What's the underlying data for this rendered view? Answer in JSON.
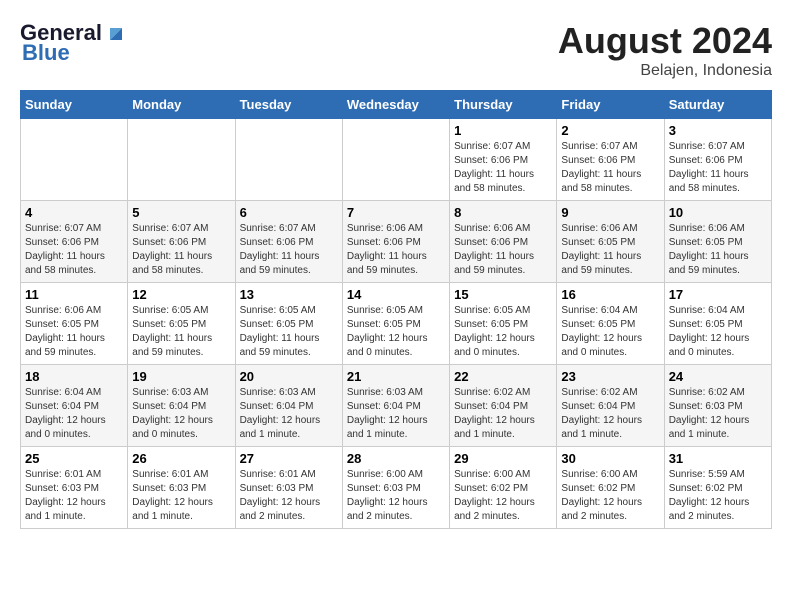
{
  "header": {
    "logo_line1": "General",
    "logo_line2": "Blue",
    "month_year": "August 2024",
    "location": "Belajen, Indonesia"
  },
  "weekdays": [
    "Sunday",
    "Monday",
    "Tuesday",
    "Wednesday",
    "Thursday",
    "Friday",
    "Saturday"
  ],
  "weeks": [
    [
      {
        "day": "",
        "info": ""
      },
      {
        "day": "",
        "info": ""
      },
      {
        "day": "",
        "info": ""
      },
      {
        "day": "",
        "info": ""
      },
      {
        "day": "1",
        "info": "Sunrise: 6:07 AM\nSunset: 6:06 PM\nDaylight: 11 hours\nand 58 minutes."
      },
      {
        "day": "2",
        "info": "Sunrise: 6:07 AM\nSunset: 6:06 PM\nDaylight: 11 hours\nand 58 minutes."
      },
      {
        "day": "3",
        "info": "Sunrise: 6:07 AM\nSunset: 6:06 PM\nDaylight: 11 hours\nand 58 minutes."
      }
    ],
    [
      {
        "day": "4",
        "info": "Sunrise: 6:07 AM\nSunset: 6:06 PM\nDaylight: 11 hours\nand 58 minutes."
      },
      {
        "day": "5",
        "info": "Sunrise: 6:07 AM\nSunset: 6:06 PM\nDaylight: 11 hours\nand 58 minutes."
      },
      {
        "day": "6",
        "info": "Sunrise: 6:07 AM\nSunset: 6:06 PM\nDaylight: 11 hours\nand 59 minutes."
      },
      {
        "day": "7",
        "info": "Sunrise: 6:06 AM\nSunset: 6:06 PM\nDaylight: 11 hours\nand 59 minutes."
      },
      {
        "day": "8",
        "info": "Sunrise: 6:06 AM\nSunset: 6:06 PM\nDaylight: 11 hours\nand 59 minutes."
      },
      {
        "day": "9",
        "info": "Sunrise: 6:06 AM\nSunset: 6:05 PM\nDaylight: 11 hours\nand 59 minutes."
      },
      {
        "day": "10",
        "info": "Sunrise: 6:06 AM\nSunset: 6:05 PM\nDaylight: 11 hours\nand 59 minutes."
      }
    ],
    [
      {
        "day": "11",
        "info": "Sunrise: 6:06 AM\nSunset: 6:05 PM\nDaylight: 11 hours\nand 59 minutes."
      },
      {
        "day": "12",
        "info": "Sunrise: 6:05 AM\nSunset: 6:05 PM\nDaylight: 11 hours\nand 59 minutes."
      },
      {
        "day": "13",
        "info": "Sunrise: 6:05 AM\nSunset: 6:05 PM\nDaylight: 11 hours\nand 59 minutes."
      },
      {
        "day": "14",
        "info": "Sunrise: 6:05 AM\nSunset: 6:05 PM\nDaylight: 12 hours\nand 0 minutes."
      },
      {
        "day": "15",
        "info": "Sunrise: 6:05 AM\nSunset: 6:05 PM\nDaylight: 12 hours\nand 0 minutes."
      },
      {
        "day": "16",
        "info": "Sunrise: 6:04 AM\nSunset: 6:05 PM\nDaylight: 12 hours\nand 0 minutes."
      },
      {
        "day": "17",
        "info": "Sunrise: 6:04 AM\nSunset: 6:05 PM\nDaylight: 12 hours\nand 0 minutes."
      }
    ],
    [
      {
        "day": "18",
        "info": "Sunrise: 6:04 AM\nSunset: 6:04 PM\nDaylight: 12 hours\nand 0 minutes."
      },
      {
        "day": "19",
        "info": "Sunrise: 6:03 AM\nSunset: 6:04 PM\nDaylight: 12 hours\nand 0 minutes."
      },
      {
        "day": "20",
        "info": "Sunrise: 6:03 AM\nSunset: 6:04 PM\nDaylight: 12 hours\nand 1 minute."
      },
      {
        "day": "21",
        "info": "Sunrise: 6:03 AM\nSunset: 6:04 PM\nDaylight: 12 hours\nand 1 minute."
      },
      {
        "day": "22",
        "info": "Sunrise: 6:02 AM\nSunset: 6:04 PM\nDaylight: 12 hours\nand 1 minute."
      },
      {
        "day": "23",
        "info": "Sunrise: 6:02 AM\nSunset: 6:04 PM\nDaylight: 12 hours\nand 1 minute."
      },
      {
        "day": "24",
        "info": "Sunrise: 6:02 AM\nSunset: 6:03 PM\nDaylight: 12 hours\nand 1 minute."
      }
    ],
    [
      {
        "day": "25",
        "info": "Sunrise: 6:01 AM\nSunset: 6:03 PM\nDaylight: 12 hours\nand 1 minute."
      },
      {
        "day": "26",
        "info": "Sunrise: 6:01 AM\nSunset: 6:03 PM\nDaylight: 12 hours\nand 1 minute."
      },
      {
        "day": "27",
        "info": "Sunrise: 6:01 AM\nSunset: 6:03 PM\nDaylight: 12 hours\nand 2 minutes."
      },
      {
        "day": "28",
        "info": "Sunrise: 6:00 AM\nSunset: 6:03 PM\nDaylight: 12 hours\nand 2 minutes."
      },
      {
        "day": "29",
        "info": "Sunrise: 6:00 AM\nSunset: 6:02 PM\nDaylight: 12 hours\nand 2 minutes."
      },
      {
        "day": "30",
        "info": "Sunrise: 6:00 AM\nSunset: 6:02 PM\nDaylight: 12 hours\nand 2 minutes."
      },
      {
        "day": "31",
        "info": "Sunrise: 5:59 AM\nSunset: 6:02 PM\nDaylight: 12 hours\nand 2 minutes."
      }
    ]
  ]
}
